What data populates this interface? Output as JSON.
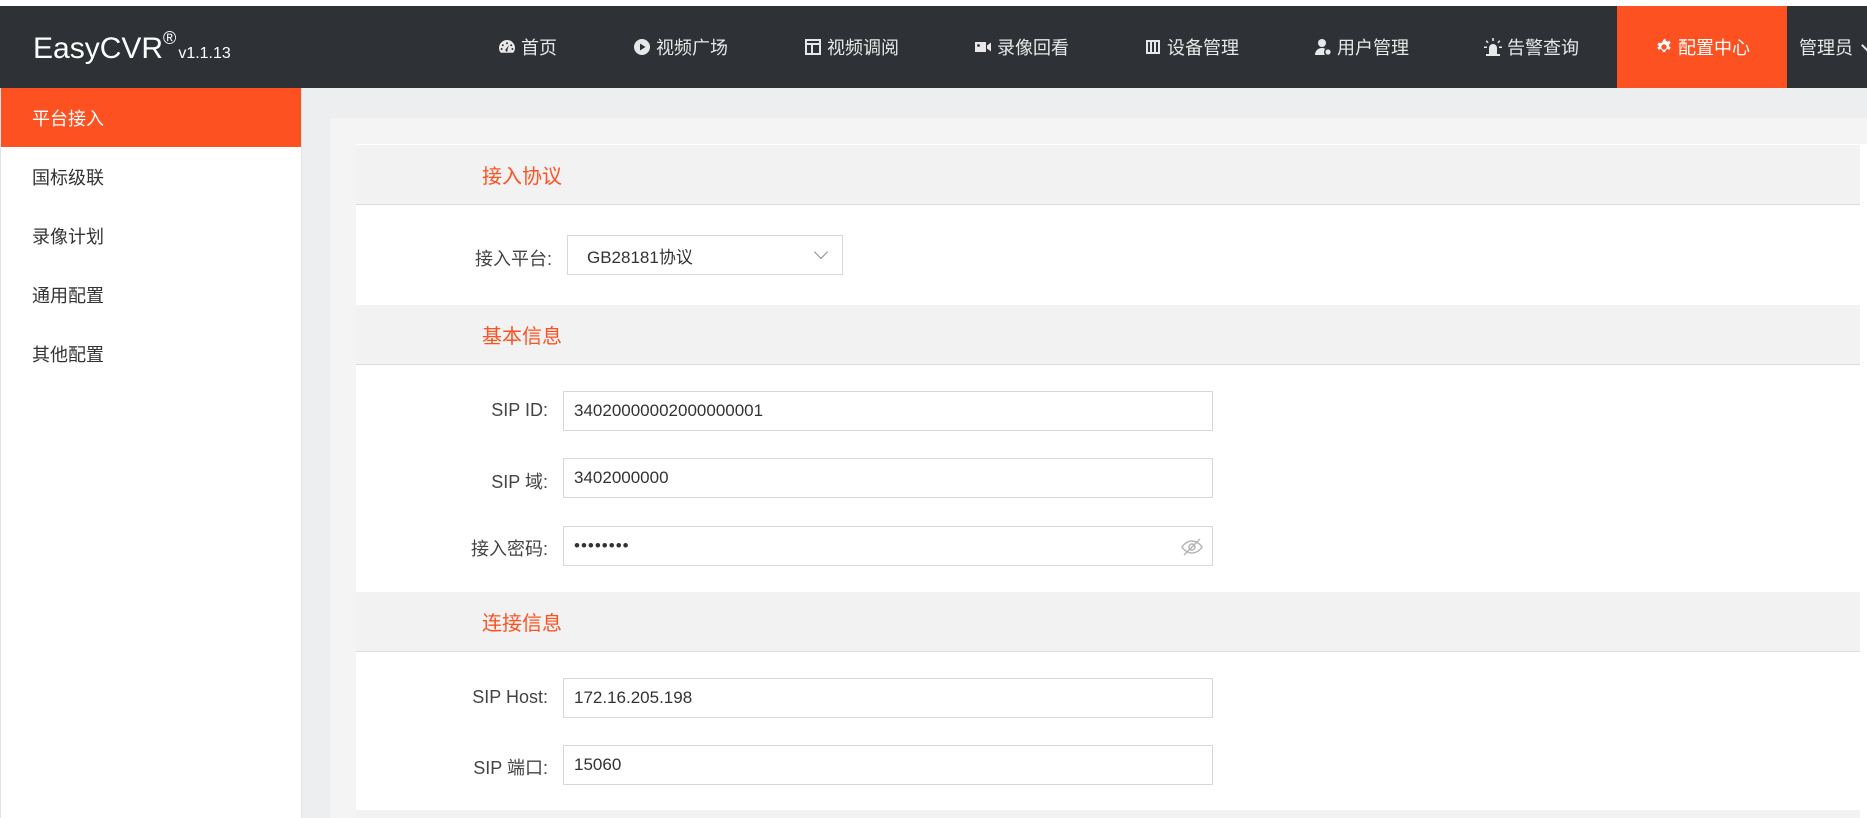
{
  "header": {
    "brand": "EasyCVR",
    "brand_reg": "®",
    "version": "v1.1.13",
    "nav": [
      {
        "label": "首页",
        "icon": "dashboard-icon"
      },
      {
        "label": "视频广场",
        "icon": "play-circle-icon"
      },
      {
        "label": "视频调阅",
        "icon": "layout-icon"
      },
      {
        "label": "录像回看",
        "icon": "video-camera-icon"
      },
      {
        "label": "设备管理",
        "icon": "device-icon"
      },
      {
        "label": "用户管理",
        "icon": "user-icon"
      },
      {
        "label": "告警查询",
        "icon": "alarm-light-icon"
      },
      {
        "label": "配置中心",
        "icon": "gear-icon",
        "active": true
      }
    ],
    "user_menu": "管理员"
  },
  "sidebar": {
    "items": [
      {
        "label": "平台接入",
        "active": true
      },
      {
        "label": "国标级联"
      },
      {
        "label": "录像计划"
      },
      {
        "label": "通用配置"
      },
      {
        "label": "其他配置"
      }
    ]
  },
  "form": {
    "section_protocol": "接入协议",
    "platform_label": "接入平台:",
    "platform_value": "GB28181协议",
    "section_basic": "基本信息",
    "sip_id_label": "SIP ID:",
    "sip_id_value": "34020000002000000001",
    "sip_domain_label": "SIP 域:",
    "sip_domain_value": "3402000000",
    "password_label": "接入密码:",
    "password_value": "••••••••",
    "section_connection": "连接信息",
    "sip_host_label": "SIP Host:",
    "sip_host_value": "172.16.205.198",
    "sip_port_label": "SIP 端口:",
    "sip_port_value": "15060"
  },
  "colors": {
    "accent": "#fe5122",
    "navbar": "#2e3135"
  }
}
